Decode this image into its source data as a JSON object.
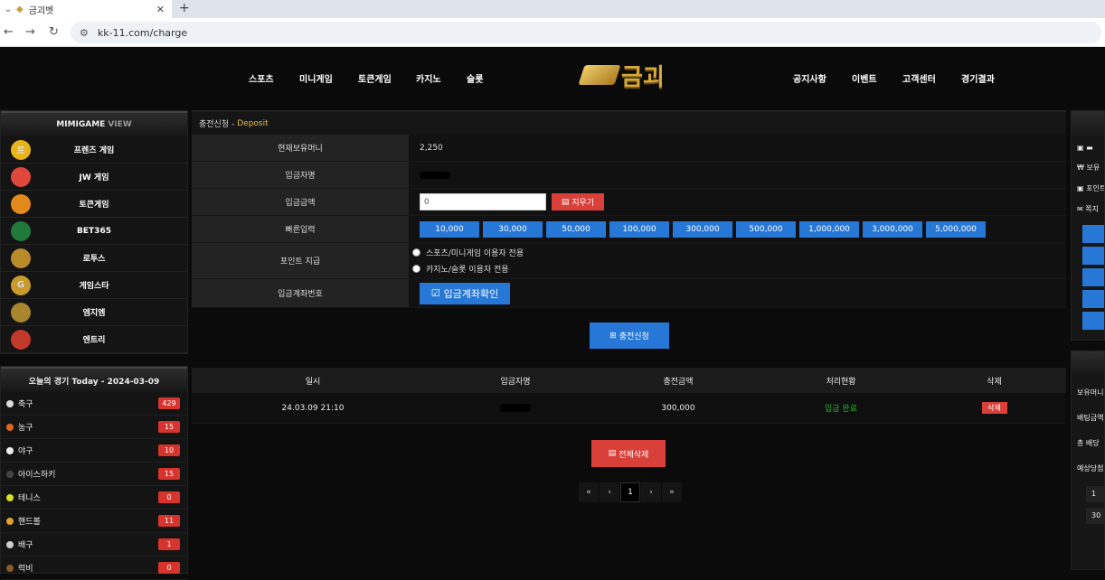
{
  "browser": {
    "tab_title": "금괴벳",
    "url": "kk-11.com/charge"
  },
  "header": {
    "nav_left": [
      "스포츠",
      "미니게임",
      "토큰게임",
      "카지노",
      "슬롯"
    ],
    "logo_text": "금괴",
    "nav_right": [
      "공지사항",
      "이벤트",
      "고객센터",
      "경기결과"
    ]
  },
  "games_panel": {
    "title": "MIMIGAME",
    "title_suffix": "VIEW",
    "items": [
      {
        "label": "프렌즈 게임",
        "icon_text": "프",
        "icon_color": "#e8b418"
      },
      {
        "label": "JW 게임",
        "icon_text": "",
        "icon_color": "#e0473c"
      },
      {
        "label": "토큰게임",
        "icon_text": "",
        "icon_color": "#e38a1d"
      },
      {
        "label": "BET365",
        "icon_text": "",
        "icon_color": "#1f7a3a"
      },
      {
        "label": "로투스",
        "icon_text": "",
        "icon_color": "#b88a2a"
      },
      {
        "label": "게임스타",
        "icon_text": "G",
        "icon_color": "#c99b2a"
      },
      {
        "label": "엠지엠",
        "icon_text": "",
        "icon_color": "#a8862e"
      },
      {
        "label": "엔트리",
        "icon_text": "",
        "icon_color": "#c0392b"
      }
    ]
  },
  "today_panel": {
    "title": "오늘의 경기 Today - 2024-03-09",
    "sports": [
      {
        "label": "축구",
        "count": "429",
        "ball_color": "#dddddd"
      },
      {
        "label": "농구",
        "count": "15",
        "ball_color": "#e0681c"
      },
      {
        "label": "야구",
        "count": "10",
        "ball_color": "#eeeeee"
      },
      {
        "label": "아이스하키",
        "count": "15",
        "ball_color": "#444444"
      },
      {
        "label": "테니스",
        "count": "0",
        "ball_color": "#d7e02a"
      },
      {
        "label": "핸드볼",
        "count": "11",
        "ball_color": "#e0a22a"
      },
      {
        "label": "배구",
        "count": "1",
        "ball_color": "#cccccc"
      },
      {
        "label": "럭비",
        "count": "0",
        "ball_color": "#8a5a2a"
      }
    ]
  },
  "deposit": {
    "breadcrumb": "충전신청 -",
    "breadcrumb_accent": "Deposit",
    "labels": {
      "balance": "현재보유머니",
      "depositor": "입금자명",
      "amount": "입금금액",
      "quick": "빠른입력",
      "point": "포인트 지급",
      "account": "입금계좌번호"
    },
    "balance_value": "2,250",
    "amount_value": "0",
    "clear_label": "지우기",
    "quick_amounts": [
      "10,000",
      "30,000",
      "50,000",
      "100,000",
      "300,000",
      "500,000",
      "1,000,000",
      "3,000,000",
      "5,000,000"
    ],
    "point_options": [
      "스포츠/미니게임 이용자 전용",
      "카지노/슬롯 이용자 전용"
    ],
    "account_check_label": "입금계좌확인",
    "submit_label": "충전신청"
  },
  "history": {
    "columns": [
      "일시",
      "입금자명",
      "충전금액",
      "처리현황",
      "삭제"
    ],
    "rows": [
      {
        "date": "24.03.09 21:10",
        "amount": "300,000",
        "status": "입금 완료",
        "status_color": "#2bb52b",
        "delete_label": "삭제"
      }
    ],
    "delete_all_label": "전체삭제",
    "pagination": {
      "first": "«",
      "prev": "‹",
      "current": "1",
      "next": "›",
      "last": "»"
    }
  },
  "right_panel": {
    "items": [
      "보유",
      "포인트",
      "쪽지"
    ],
    "bet_items": [
      "보유머니",
      "배팅금액",
      "총 배당",
      "예상당첨"
    ],
    "bet_inputs": [
      "1",
      "30"
    ]
  }
}
